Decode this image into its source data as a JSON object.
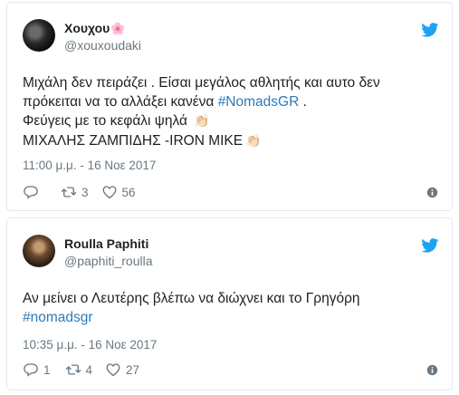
{
  "tweets": [
    {
      "name": "Χουχου",
      "name_emoji": "🌸",
      "handle": "@xouxoudaki",
      "text_lines": [
        "Μιχάλη δεν πειράζει . Είσαι μεγάλος αθλητής και αυτο δεν",
        "πρόκειται να το αλλάξει κανένα ",
        "Φεύγεις με το κεφάλι ψηλά ",
        "ΜΙΧΑΛΗΣ ΖΑΜΠΙΔΗΣ -IRON MIKE"
      ],
      "hashtag": "#NomadsGR",
      "after_hashtag": " .",
      "emoji": "👏🏻",
      "timestamp": "11:00 μ.μ. - 16 Νοε 2017",
      "replies": "",
      "retweets": "3",
      "likes": "56"
    },
    {
      "name": "Roulla Paphiti",
      "handle": "@paphiti_roulla",
      "text_lines": [
        "Αν μείνει ο Λευτέρης βλέπω να διώχνει και το Γρηγόρη"
      ],
      "hashtag": "#nomadsgr",
      "timestamp": "10:35 μ.μ. - 16 Νοε 2017",
      "replies": "1",
      "retweets": "4",
      "likes": "27"
    }
  ],
  "icons": {
    "brand": "twitter-bird-icon",
    "reply": "reply-icon",
    "retweet": "retweet-icon",
    "like": "heart-icon",
    "info": "info-icon"
  },
  "colors": {
    "brand": "#1da1f2",
    "link": "#2b7bb9",
    "text": "#1c2022",
    "muted": "#697882",
    "border": "#e1e8ed"
  }
}
